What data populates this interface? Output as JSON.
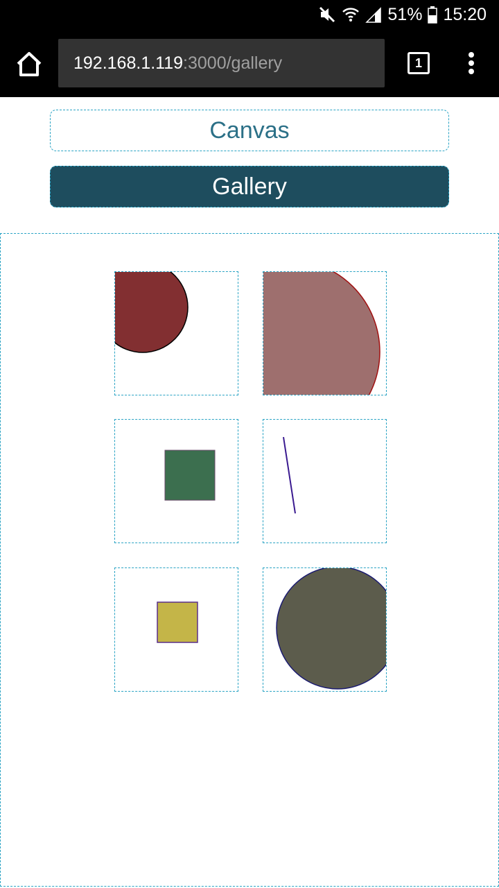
{
  "status_bar": {
    "battery": "51%",
    "time": "15:20",
    "icons": [
      "mute-icon",
      "wifi-icon",
      "signal-icon",
      "battery-icon"
    ]
  },
  "browser": {
    "url_host": "192.168.1.119",
    "url_path": ":3000/gallery",
    "tab_count": "1",
    "icons": [
      "home-icon",
      "more-vert-icon"
    ]
  },
  "nav": {
    "canvas_label": "Canvas",
    "gallery_label": "Gallery"
  },
  "gallery": {
    "items": [
      {
        "shape": "circle",
        "fill": "#822f31",
        "stroke": "#000000"
      },
      {
        "shape": "circle",
        "fill": "#9e6f6e",
        "stroke": "#a01010"
      },
      {
        "shape": "square",
        "fill": "#3c6f4f",
        "stroke": "#6a4a6a"
      },
      {
        "shape": "line",
        "fill": "",
        "stroke": "#3a1a90"
      },
      {
        "shape": "square",
        "fill": "#c4b548",
        "stroke": "#5a2e8c"
      },
      {
        "shape": "circle",
        "fill": "#5c5c4c",
        "stroke": "#1a1a70"
      }
    ]
  },
  "colors": {
    "accent_dashed": "#29a3c4",
    "button_dark": "#1e4d5e",
    "button_text_light": "#2b7087"
  }
}
